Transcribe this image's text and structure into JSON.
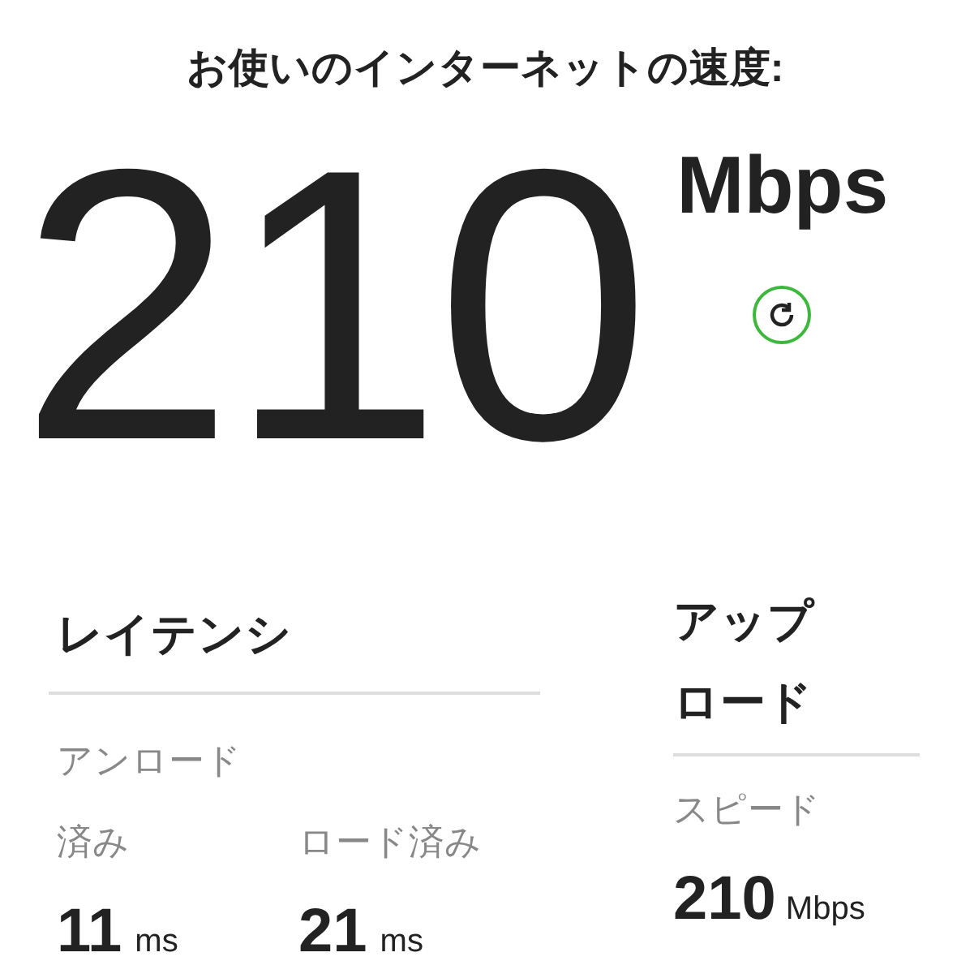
{
  "title": "お使いのインターネットの速度:",
  "speed": {
    "value": "210",
    "unit": "Mbps"
  },
  "latency": {
    "heading": "レイテンシ",
    "items": [
      {
        "label": "アンロード済み",
        "value": "11",
        "unit": "ms"
      },
      {
        "label": "ロード済み",
        "value": "21",
        "unit": "ms"
      }
    ]
  },
  "upload": {
    "heading": "アップロード",
    "label": "スピード",
    "value": "210",
    "unit": "Mbps"
  }
}
